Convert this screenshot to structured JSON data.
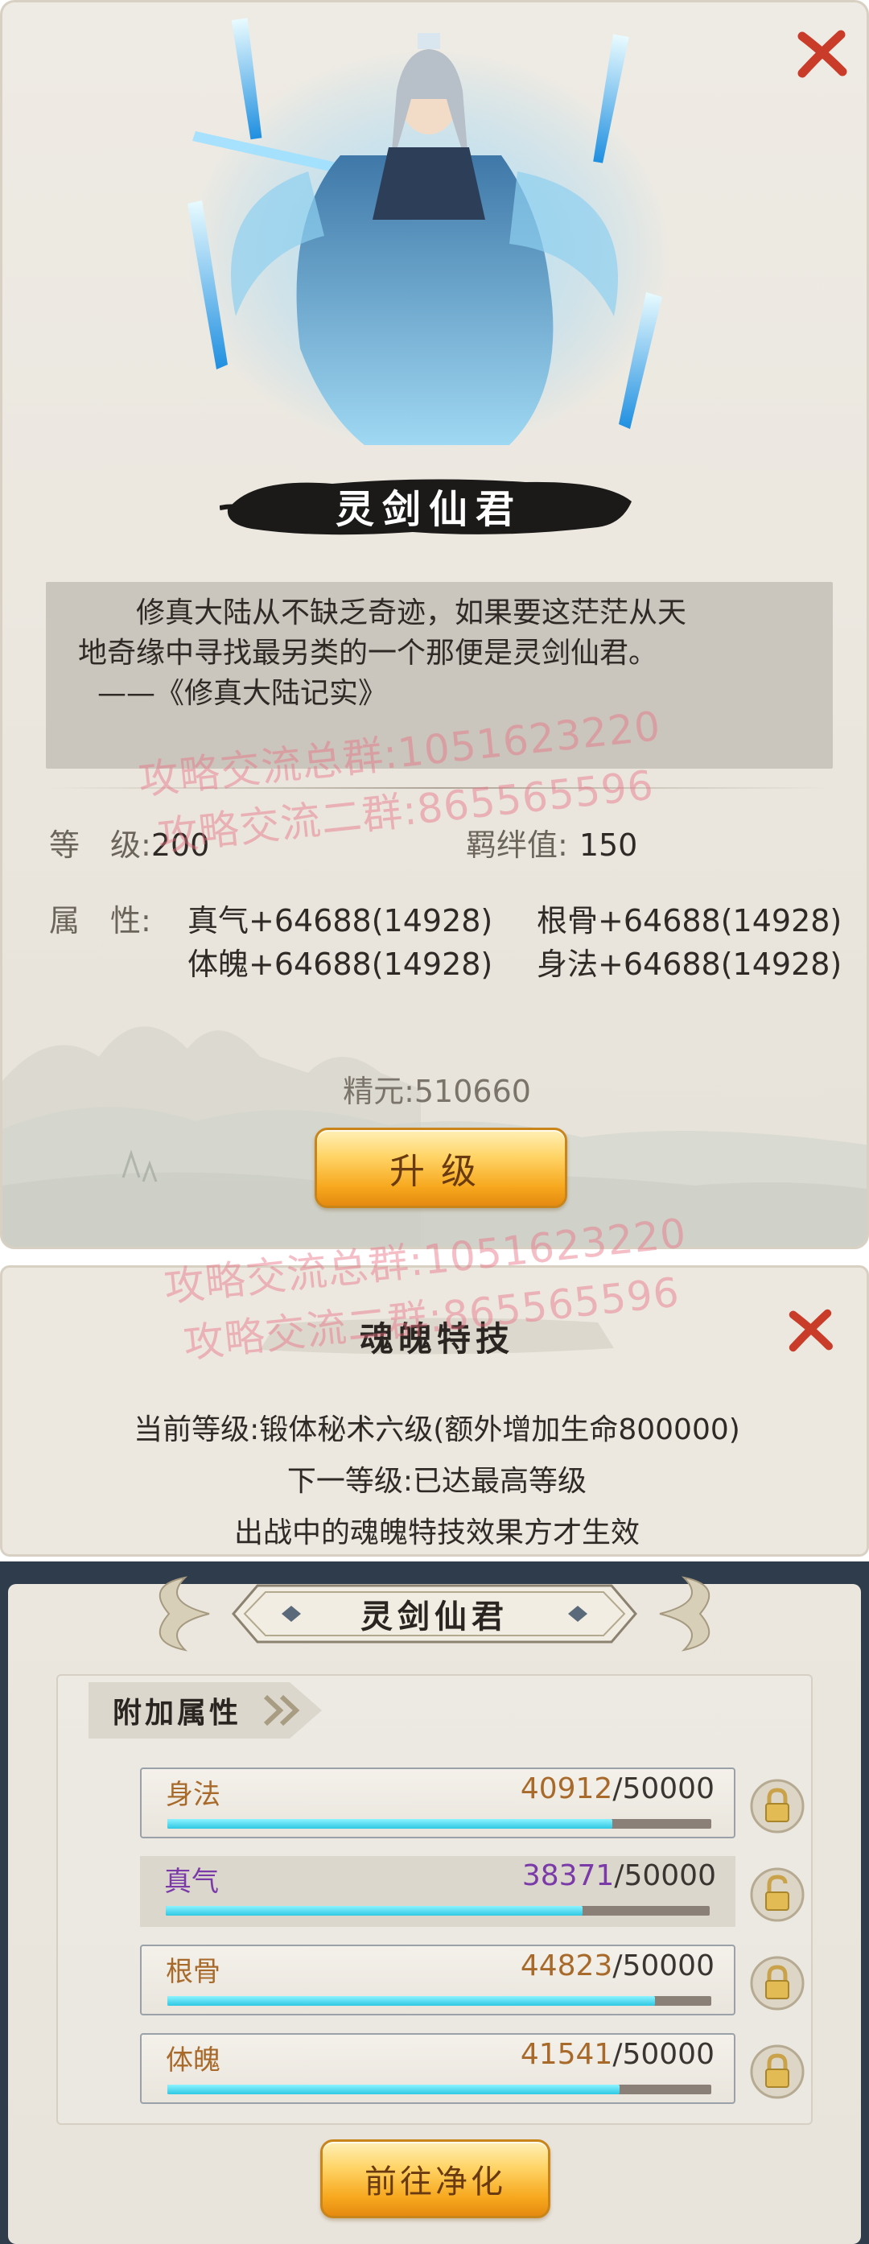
{
  "hero": {
    "name": "灵剑仙君",
    "quote_line1": "修真大陆从不缺乏奇迹，如果要这茫茫从天",
    "quote_line2": "地奇缘中寻找最另类的一个那便是灵剑仙君。",
    "quote_line3": "——《修真大陆记实》",
    "level_label": "等　级:",
    "level_value": "200",
    "bond_label": "羁绊值:",
    "bond_value": "150",
    "attr_label": "属　性:",
    "attributes": [
      "真气+64688(14928)",
      "根骨+64688(14928)",
      "体魄+64688(14928)",
      "身法+64688(14928)"
    ],
    "essence": "精元:510660",
    "upgrade_button": "升级"
  },
  "watermarks": [
    "攻略交流总群:1051623220",
    "攻略交流二群:865565596"
  ],
  "skill": {
    "title": "魂魄特技",
    "current_level": "当前等级:锻体秘术六级(额外增加生命800000)",
    "next_level": "下一等级:已达最高等级",
    "note": "出战中的魂魄特技效果方才生效"
  },
  "purify": {
    "title": "灵剑仙君",
    "section_tag": "附加属性",
    "rows": [
      {
        "name": "身法",
        "current": "40912",
        "max": "/50000",
        "fraction": 0.818,
        "name_color": "#a86a2a",
        "locked": true
      },
      {
        "name": "真气",
        "current": "38371",
        "max": "/50000",
        "fraction": 0.767,
        "name_color": "#7a3aa8",
        "locked": false
      },
      {
        "name": "根骨",
        "current": "44823",
        "max": "/50000",
        "fraction": 0.896,
        "name_color": "#a86a2a",
        "locked": true
      },
      {
        "name": "体魄",
        "current": "41541",
        "max": "/50000",
        "fraction": 0.831,
        "name_color": "#a86a2a",
        "locked": true
      }
    ],
    "button": "前往净化"
  }
}
